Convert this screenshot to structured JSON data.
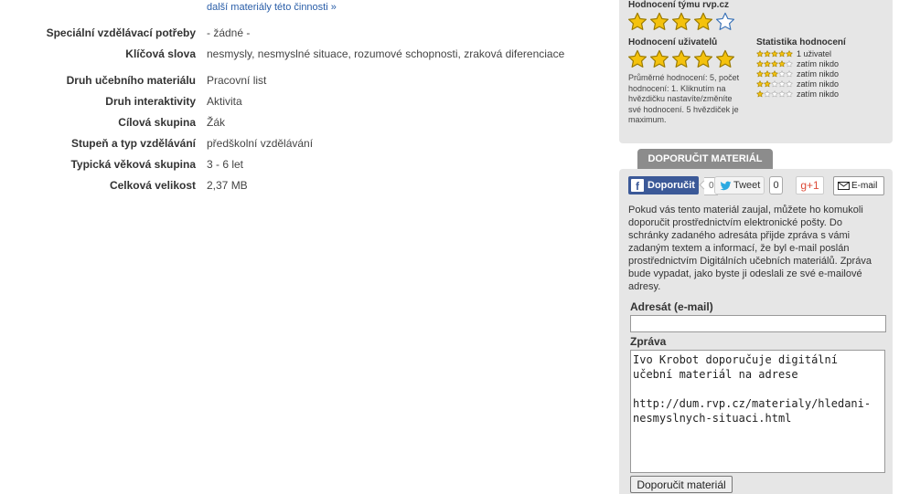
{
  "more_link": "další materiály této činnosti »",
  "details": [
    {
      "label": "Speciální vzdělávací potřeby",
      "value": "- žádné -"
    },
    {
      "label": "Klíčová slova",
      "value": "nesmysly, nesmyslné situace, rozumové schopnosti, zraková diferenciace"
    },
    {
      "label": "Druh učebního materiálu",
      "value": "Pracovní list"
    },
    {
      "label": "Druh interaktivity",
      "value": "Aktivita"
    },
    {
      "label": "Cílová skupina",
      "value": "Žák"
    },
    {
      "label": "Stupeň a typ vzdělávání",
      "value": "předškolní vzdělávání"
    },
    {
      "label": "Typická věková skupina",
      "value": "3 - 6 let"
    },
    {
      "label": "Celková velikost",
      "value": "2,37 MB"
    }
  ],
  "rating": {
    "team_title": "Hodnocení týmu rvp.cz",
    "team_stars": 4,
    "user_title": "Hodnocení uživatelů",
    "user_stars": 5,
    "user_note": "Průměrné hodnocení: 5, počet hodnocení: 1. Kliknutím na hvězdičku nastavíte/změníte své hodnocení. 5 hvězdiček je maximum.",
    "stats_title": "Statistika hodnocení",
    "stats": [
      {
        "stars": 5,
        "text": "1 uživatel"
      },
      {
        "stars": 4,
        "text": "zatím nikdo"
      },
      {
        "stars": 3,
        "text": "zatím nikdo"
      },
      {
        "stars": 2,
        "text": "zatím nikdo"
      },
      {
        "stars": 1,
        "text": "zatím nikdo"
      }
    ],
    "star_color": "#f4c20d"
  },
  "recommend": {
    "tab_label": "DOPORUČIT MATERIÁL",
    "fb_label": "Doporučit",
    "fb_count": "0",
    "tweet_label": "Tweet",
    "tweet_count": "0",
    "gplus_label": "g+1",
    "email_label": "E-mail",
    "description": "Pokud vás tento materiál zaujal, můžete ho komukoli doporučit prostřednictvím elektronické pošty. Do schránky zadaného adresáta přijde zpráva s vámi zadaným textem a informací, že byl e-mail poslán prostřednictvím Digitálních učebních materiálů. Zpráva bude vypadat, jako byste ji odeslali ze své e-mailové adresy.",
    "address_label": "Adresát (e-mail)",
    "address_value": "",
    "message_label": "Zpráva",
    "message_value": "Ivo Krobot doporučuje digitální učební materiál na adrese\n\nhttp://dum.rvp.cz/materialy/hledani-nesmyslnych-situaci.html",
    "submit_label": "Doporučit materiál"
  }
}
